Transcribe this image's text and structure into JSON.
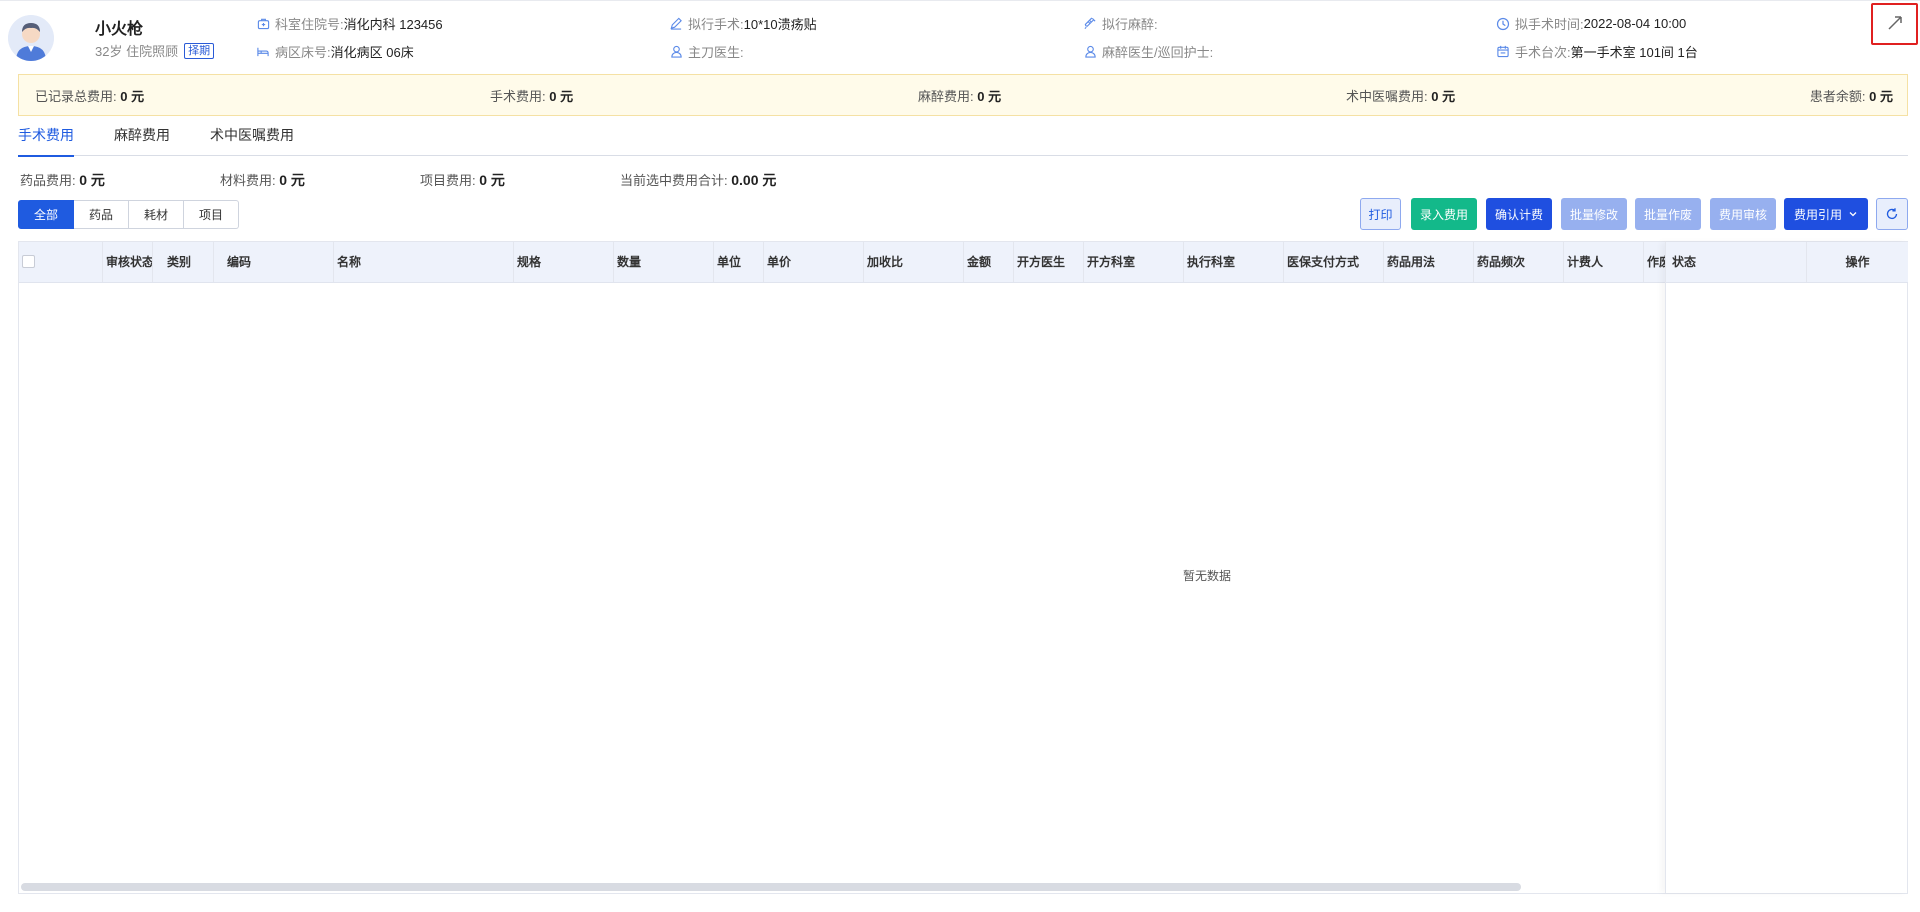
{
  "patient": {
    "name": "小火枪",
    "age_ward": "32岁 住院照顾",
    "tag": "择期"
  },
  "header_info": [
    {
      "icon": "building-icon",
      "label": "科室住院号:",
      "value": "消化内科 123456"
    },
    {
      "icon": "bed-icon",
      "label": "病区床号:",
      "value": "消化病区 06床"
    },
    {
      "icon": "pen-icon",
      "label": "拟行手术:",
      "value": "10*10溃疡贴"
    },
    {
      "icon": "user-icon",
      "label": "主刀医生:",
      "value": ""
    },
    {
      "icon": "syringe-icon",
      "label": "拟行麻醉:",
      "value": ""
    },
    {
      "icon": "user-icon",
      "label": "麻醉医生/巡回护士:",
      "value": ""
    },
    {
      "icon": "clock-icon",
      "label": "拟手术时间:",
      "value": "2022-08-04 10:00"
    },
    {
      "icon": "calendar-icon",
      "label": "手术台次:",
      "value": "第一手术室 101间 1台"
    }
  ],
  "summary": [
    {
      "label": "已记录总费用: ",
      "value": "0 元"
    },
    {
      "label": "手术费用: ",
      "value": "0 元"
    },
    {
      "label": "麻醉费用: ",
      "value": "0 元"
    },
    {
      "label": "术中医嘱费用: ",
      "value": "0 元"
    },
    {
      "label": "患者余额: ",
      "value": "0 元"
    }
  ],
  "tabs": [
    "手术费用",
    "麻醉费用",
    "术中医嘱费用"
  ],
  "fee_stats": [
    {
      "label": "药品费用: ",
      "value": "0 元"
    },
    {
      "label": "材料费用: ",
      "value": "0 元"
    },
    {
      "label": "项目费用: ",
      "value": "0 元"
    },
    {
      "label": "当前选中费用合计: ",
      "value": "0.00 元"
    }
  ],
  "filters": [
    "全部",
    "药品",
    "耗材",
    "项目"
  ],
  "actions": {
    "print": "打印",
    "enter_fee": "录入费用",
    "confirm_billing": "确认计费",
    "batch_edit": "批量修改",
    "batch_void": "批量作废",
    "fee_audit": "费用审核",
    "fee_reference": "费用引用"
  },
  "table": {
    "columns": [
      "审核状态",
      "类别",
      "编码",
      "名称",
      "规格",
      "数量",
      "单位",
      "单价",
      "加收比",
      "金额",
      "开方医生",
      "开方科室",
      "执行科室",
      "医保支付方式",
      "药品用法",
      "药品频次",
      "计费人",
      "作废"
    ],
    "fixed_columns": [
      "状态",
      "操作"
    ],
    "empty_text": "暂无数据"
  },
  "colors": {
    "primary": "#1f5be0",
    "green": "#13b98a",
    "light_blue": "#97b0ef",
    "summary_bg": "#fffbea",
    "highlight_border": "#e02020"
  }
}
